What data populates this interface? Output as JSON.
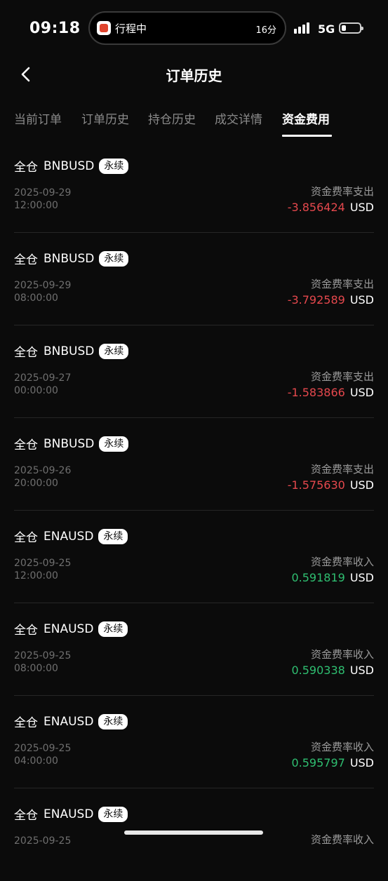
{
  "status_bar": {
    "time": "09:18",
    "live_activity": {
      "app_icon": "trip-app-icon",
      "label": "行程中",
      "duration": "16分"
    },
    "network": "5G",
    "signal_icon": "signal-bars-icon",
    "battery_icon": "battery-icon"
  },
  "header": {
    "title": "订单历史",
    "back_icon": "chevron-left-icon"
  },
  "tabs": [
    {
      "label": "当前订单",
      "active": false
    },
    {
      "label": "订单历史",
      "active": false
    },
    {
      "label": "持仓历史",
      "active": false
    },
    {
      "label": "成交详情",
      "active": false
    },
    {
      "label": "资金费用",
      "active": true
    }
  ],
  "records": [
    {
      "margin_mode": "全仓",
      "symbol": "BNBUSD",
      "badge": "永续",
      "date": "2025-09-29",
      "time": "12:00:00",
      "type": "资金费率支出",
      "amount": "-3.856424",
      "unit": "USD",
      "sign": "negative"
    },
    {
      "margin_mode": "全仓",
      "symbol": "BNBUSD",
      "badge": "永续",
      "date": "2025-09-29",
      "time": "08:00:00",
      "type": "资金费率支出",
      "amount": "-3.792589",
      "unit": "USD",
      "sign": "negative"
    },
    {
      "margin_mode": "全仓",
      "symbol": "BNBUSD",
      "badge": "永续",
      "date": "2025-09-27",
      "time": "00:00:00",
      "type": "资金费率支出",
      "amount": "-1.583866",
      "unit": "USD",
      "sign": "negative"
    },
    {
      "margin_mode": "全仓",
      "symbol": "BNBUSD",
      "badge": "永续",
      "date": "2025-09-26",
      "time": "20:00:00",
      "type": "资金费率支出",
      "amount": "-1.575630",
      "unit": "USD",
      "sign": "negative"
    },
    {
      "margin_mode": "全仓",
      "symbol": "ENAUSD",
      "badge": "永续",
      "date": "2025-09-25",
      "time": "12:00:00",
      "type": "资金费率收入",
      "amount": "0.591819",
      "unit": "USD",
      "sign": "positive"
    },
    {
      "margin_mode": "全仓",
      "symbol": "ENAUSD",
      "badge": "永续",
      "date": "2025-09-25",
      "time": "08:00:00",
      "type": "资金费率收入",
      "amount": "0.590338",
      "unit": "USD",
      "sign": "positive"
    },
    {
      "margin_mode": "全仓",
      "symbol": "ENAUSD",
      "badge": "永续",
      "date": "2025-09-25",
      "time": "04:00:00",
      "type": "资金费率收入",
      "amount": "0.595797",
      "unit": "USD",
      "sign": "positive"
    },
    {
      "margin_mode": "全仓",
      "symbol": "ENAUSD",
      "badge": "永续",
      "date": "2025-09-25",
      "time": "",
      "type": "资金费率收入",
      "amount": "",
      "unit": "",
      "sign": "positive"
    }
  ],
  "colors": {
    "negative": "#e5484d",
    "positive": "#2fbf71",
    "background": "#0b0b0b"
  }
}
